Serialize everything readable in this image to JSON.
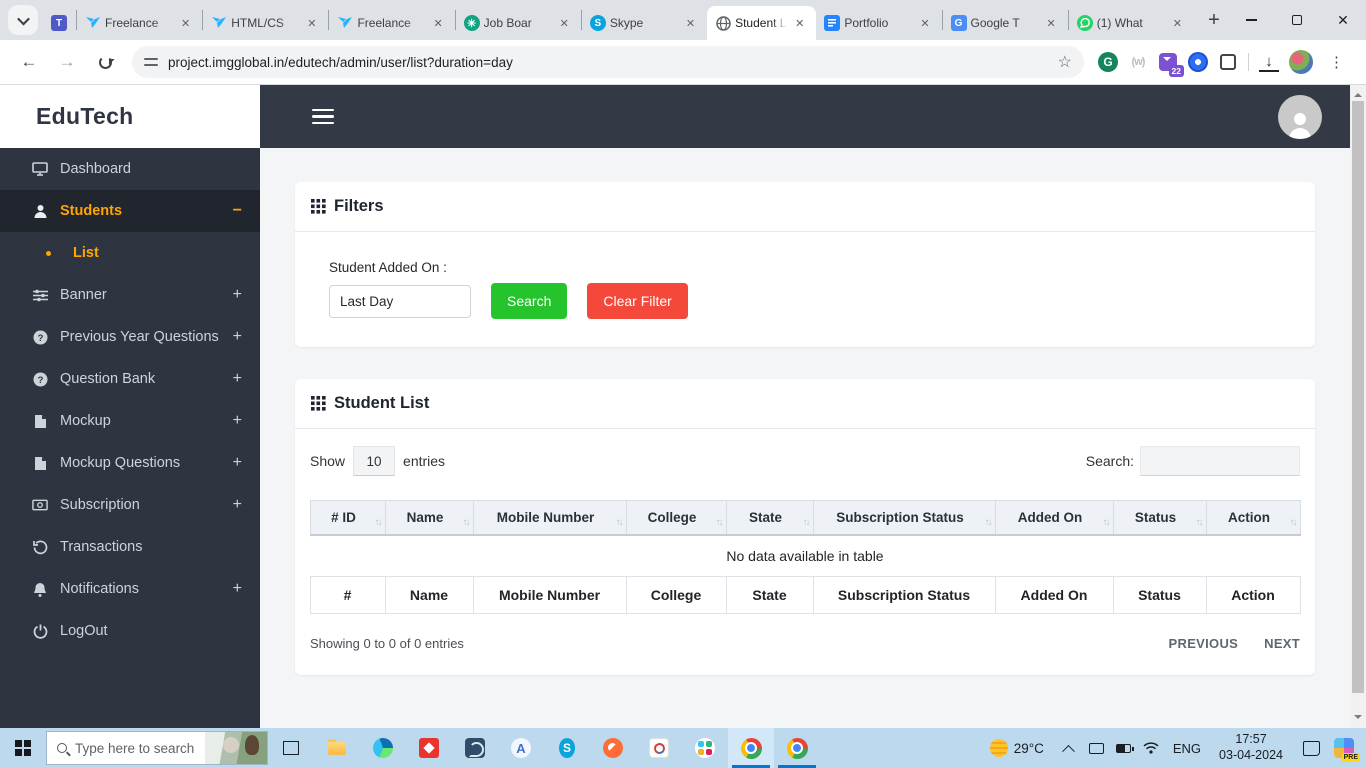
{
  "browser": {
    "tabs": [
      {
        "title": "",
        "icon": "teams",
        "pinned": true,
        "active": false
      },
      {
        "title": "Freelance",
        "icon": "freelancer",
        "active": false
      },
      {
        "title": "HTML/CS",
        "icon": "freelancer",
        "active": false
      },
      {
        "title": "Freelance",
        "icon": "freelancer",
        "active": false
      },
      {
        "title": "Job Boar",
        "icon": "chatgpt",
        "active": false
      },
      {
        "title": "Skype",
        "icon": "skype",
        "active": false
      },
      {
        "title": "Student L",
        "icon": "globe",
        "active": true
      },
      {
        "title": "Portfolio",
        "icon": "docs",
        "active": false
      },
      {
        "title": "Google T",
        "icon": "translate",
        "active": false
      },
      {
        "title": "(1) What",
        "icon": "whatsapp",
        "active": false
      }
    ],
    "url": "project.imgglobal.in/edutech/admin/user/list?duration=day",
    "extension_badge": "22",
    "icon_glyphs": {
      "teams": "T",
      "skype": "S",
      "chatgpt": "✳",
      "translate": "G",
      "grammarly": "G",
      "wayback": "(w)",
      "a_app": "A"
    }
  },
  "sidebar": {
    "logo": "EduTech",
    "items": [
      {
        "label": "Dashboard",
        "icon": "monitor",
        "toggle": ""
      },
      {
        "label": "Students",
        "icon": "user",
        "toggle": "−",
        "active": true
      },
      {
        "label": "List",
        "icon": "bullet",
        "toggle": "",
        "sub": true
      },
      {
        "label": "Banner",
        "icon": "sliders",
        "toggle": "+"
      },
      {
        "label": "Previous Year Questions",
        "icon": "question-circle",
        "toggle": "+"
      },
      {
        "label": "Question Bank",
        "icon": "question-circle",
        "toggle": "+"
      },
      {
        "label": "Mockup",
        "icon": "file",
        "toggle": "+"
      },
      {
        "label": "Mockup Questions",
        "icon": "file",
        "toggle": "+"
      },
      {
        "label": "Subscription",
        "icon": "banknote",
        "toggle": "+"
      },
      {
        "label": "Transactions",
        "icon": "history",
        "toggle": ""
      },
      {
        "label": "Notifications",
        "icon": "bell",
        "toggle": "+"
      },
      {
        "label": "LogOut",
        "icon": "power",
        "toggle": ""
      }
    ]
  },
  "filters": {
    "title": "Filters",
    "label": "Student Added On :",
    "input_value": "Last Day",
    "search_button": "Search",
    "clear_button": "Clear Filter"
  },
  "student_list": {
    "title": "Student List",
    "show_label": "Show",
    "entries_value": "10",
    "entries_label": "entries",
    "search_label": "Search:",
    "columns": [
      "# ID",
      "Name",
      "Mobile Number",
      "College",
      "State",
      "Subscription Status",
      "Added On",
      "Status",
      "Action"
    ],
    "footer_columns": [
      "#",
      "Name",
      "Mobile Number",
      "College",
      "State",
      "Subscription Status",
      "Added On",
      "Status",
      "Action"
    ],
    "empty_text": "No data available in table",
    "summary": "Showing 0 to 0 of 0 entries",
    "prev_label": "PREVIOUS",
    "next_label": "NEXT"
  },
  "taskbar": {
    "search_placeholder": "Type here to search",
    "temperature": "29°C",
    "language": "ENG",
    "time": "17:57",
    "date": "03-04-2024",
    "copilot_badge": "PRE"
  },
  "colors": {
    "accent_orange": "#ffa502",
    "button_green": "#26c42c",
    "button_red": "#f4483b",
    "sidebar_bg": "#2e3540",
    "topbar_bg": "#333a46",
    "taskbar_bg": "#bdd9ee"
  }
}
